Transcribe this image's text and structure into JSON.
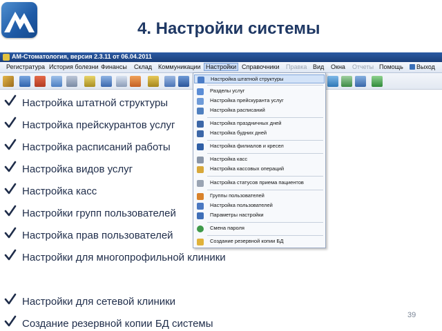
{
  "logo": {
    "text": "AM",
    "bg_color": "#1e5aa6"
  },
  "slide": {
    "title": "4. Настройки системы",
    "page_number": "39"
  },
  "window": {
    "title": "АМ-Стоматология, версия 2.3.11 от 06.04.2011"
  },
  "menubar": {
    "items": [
      {
        "label": "Регистратура"
      },
      {
        "label": "История болезни"
      },
      {
        "label": "Финансы"
      },
      {
        "label": "Склад"
      },
      {
        "label": "Коммуникации"
      },
      {
        "label": "Настройки"
      },
      {
        "label": "Справочники"
      },
      {
        "label": "Правка"
      },
      {
        "label": "Вид"
      },
      {
        "label": "Окна"
      },
      {
        "label": "Отчеты"
      },
      {
        "label": "Помощь"
      },
      {
        "label": "Выход"
      }
    ]
  },
  "checklist": [
    {
      "text": "Настройка штатной структуры"
    },
    {
      "text": "Настройка прейскурантов услуг"
    },
    {
      "text": "Настройка расписаний работы"
    },
    {
      "text": "Настройка видов услуг"
    },
    {
      "text": "Настройка касс"
    },
    {
      "text": "Настройки групп пользователей"
    },
    {
      "text": "Настройка прав  пользователей"
    },
    {
      "text": "Настройки  для многопрофильной клиники"
    },
    {
      "text": "Настройки для  сетевой клиники"
    },
    {
      "text": "Создание резервной копии БД системы"
    }
  ],
  "dropdown": {
    "items": [
      {
        "label": "Настройка штатной структуры",
        "icon": "structure-icon",
        "color": "#4a7cc7"
      },
      {
        "label": "Разделы услуг",
        "icon": "sections-icon",
        "color": "#5b8dd6"
      },
      {
        "label": "Настройка прейскуранта услуг",
        "icon": "price-list-icon",
        "color": "#6f9bd8"
      },
      {
        "label": "Настройка расписаний",
        "icon": "schedule-icon",
        "color": "#4f7fbf"
      },
      {
        "label": "Настройка праздничных дней",
        "icon": "holiday-calendar-icon",
        "color": "#3c67a8"
      },
      {
        "label": "Настройка будних дней",
        "icon": "weekday-calendar-icon",
        "color": "#3c67a8"
      },
      {
        "label": "Настройка филиалов и кресел",
        "icon": "branches-icon",
        "color": "#2f5fa6"
      },
      {
        "label": "Настройка касс",
        "icon": "cash-register-icon",
        "color": "#8a96a8"
      },
      {
        "label": "Настройка кассовых операций",
        "icon": "cash-operations-icon",
        "color": "#d8a83a"
      },
      {
        "label": "Настройка статусов приема пациентов",
        "icon": "status-icon",
        "color": "#9aa4b3"
      },
      {
        "label": "Группы пользователей",
        "icon": "user-groups-icon",
        "color": "#d9822b"
      },
      {
        "label": "Настройка пользователей",
        "icon": "users-icon",
        "color": "#4a78c2"
      },
      {
        "label": "Параметры настройки",
        "icon": "parameters-icon",
        "color": "#3f6fb8"
      },
      {
        "label": "Смена пароля",
        "icon": "password-icon",
        "color": "#3f9a4a"
      },
      {
        "label": "Создание резервной копии БД",
        "icon": "backup-database-icon",
        "color": "#e0b23a"
      }
    ]
  },
  "colors": {
    "accent": "#1f3864",
    "check": "#1f2d4a",
    "selection": "#d3e3f8"
  }
}
